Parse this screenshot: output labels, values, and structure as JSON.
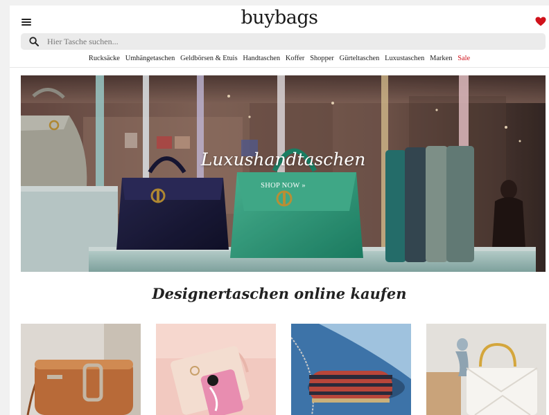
{
  "header": {
    "logo": "buybags",
    "menu_icon": "hamburger-menu-icon",
    "wishlist_icon": "heart-icon",
    "accent": "#d0121b"
  },
  "search": {
    "placeholder": "Hier Tasche suchen...",
    "value": ""
  },
  "nav": {
    "items": [
      "Rucksäcke",
      "Umhängetaschen",
      "Geldbörsen & Etuis",
      "Handtaschen",
      "Koffer",
      "Shopper",
      "Gürteltaschen",
      "Luxustaschen",
      "Marken",
      "Sale"
    ]
  },
  "hero": {
    "title": "Luxushandtaschen",
    "cta": "SHOP NOW »"
  },
  "section": {
    "title": "Designertaschen online kaufen"
  },
  "tiles": [
    {
      "icon": "tan-camera-bag-image"
    },
    {
      "icon": "pink-flamingo-clutch-image"
    },
    {
      "icon": "striped-minaudiere-image"
    },
    {
      "icon": "white-quilted-handbag-image"
    }
  ]
}
